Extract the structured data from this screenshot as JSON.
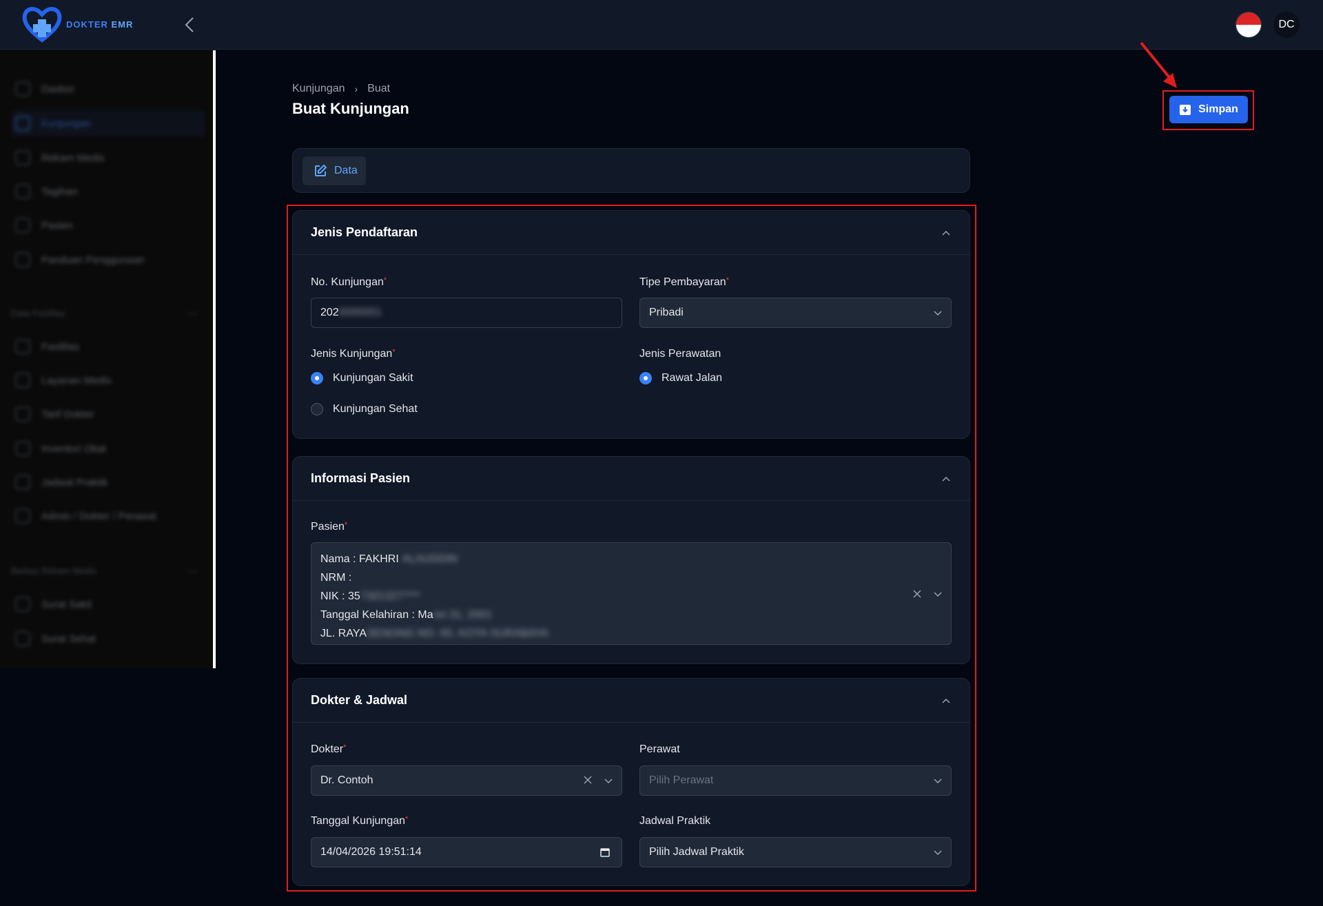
{
  "app": {
    "logo_text_a": "DOKTER",
    "logo_text_b": "EMR",
    "avatar_initials": "DC"
  },
  "sidebar": {
    "items": [
      {
        "label": "Dasbor"
      },
      {
        "label": "Kunjungan"
      },
      {
        "label": "Rekam Medis"
      },
      {
        "label": "Tagihan"
      },
      {
        "label": "Pasien"
      },
      {
        "label": "Panduan Penggunaan"
      }
    ],
    "section_master": "Data Fasilitas",
    "master_items": [
      {
        "label": "Fasilitas"
      },
      {
        "label": "Layanan Medis"
      },
      {
        "label": "Tarif Dokter"
      },
      {
        "label": "Inventori Obat"
      },
      {
        "label": "Jadwal Praktik"
      },
      {
        "label": "Admin / Dokter / Perawat"
      }
    ],
    "section_docs": "Berkas Rekam Medis",
    "doc_items": [
      {
        "label": "Surat Sakit"
      },
      {
        "label": "Surat Sehat"
      }
    ]
  },
  "breadcrumb": {
    "parent": "Kunjungan",
    "current": "Buat"
  },
  "page": {
    "title": "Buat Kunjungan",
    "save_label": "Simpan"
  },
  "tabs": {
    "data_label": "Data"
  },
  "registration": {
    "title": "Jenis Pendaftaran",
    "visit_no_label": "No. Kunjungan",
    "visit_no_value": "202",
    "visit_no_hidden": "6000001",
    "payment_label": "Tipe Pembayaran",
    "payment_value": "Pribadi",
    "visit_type_label": "Jenis Kunjungan",
    "visit_type_options": [
      "Kunjungan Sakit",
      "Kunjungan Sehat"
    ],
    "visit_type_selected": "Kunjungan Sakit",
    "care_type_label": "Jenis Perawatan",
    "care_type_options": [
      "Rawat Jalan"
    ],
    "care_type_selected": "Rawat Jalan"
  },
  "patient": {
    "title": "Informasi Pasien",
    "label": "Pasien",
    "name_prefix": "Nama : FAKHRI",
    "name_hidden": "ALAUDDIN",
    "nrm_prefix": "NRM :",
    "nik_prefix": "NIK : 35",
    "nik_hidden": "7301327****",
    "dob_prefix": "Tanggal Kelahiran : Ma",
    "dob_hidden": "ret 31, 2001",
    "address_prefix": "JL. RAYA",
    "address_hidden": "SENONG NO. 65, KOTA SURABAYA"
  },
  "doctor": {
    "title": "Dokter & Jadwal",
    "doctor_label": "Dokter",
    "doctor_value": "Dr. Contoh",
    "nurse_label": "Perawat",
    "nurse_placeholder": "Pilih Perawat",
    "date_label": "Tanggal Kunjungan",
    "date_value": "14/04/2026 19:51:14",
    "schedule_label": "Jadwal Praktik",
    "schedule_value": "Pilih Jadwal Praktik"
  },
  "colors": {
    "accent": "#2563eb",
    "highlight": "#e11d1d",
    "background": "#030712",
    "card": "#111827"
  }
}
